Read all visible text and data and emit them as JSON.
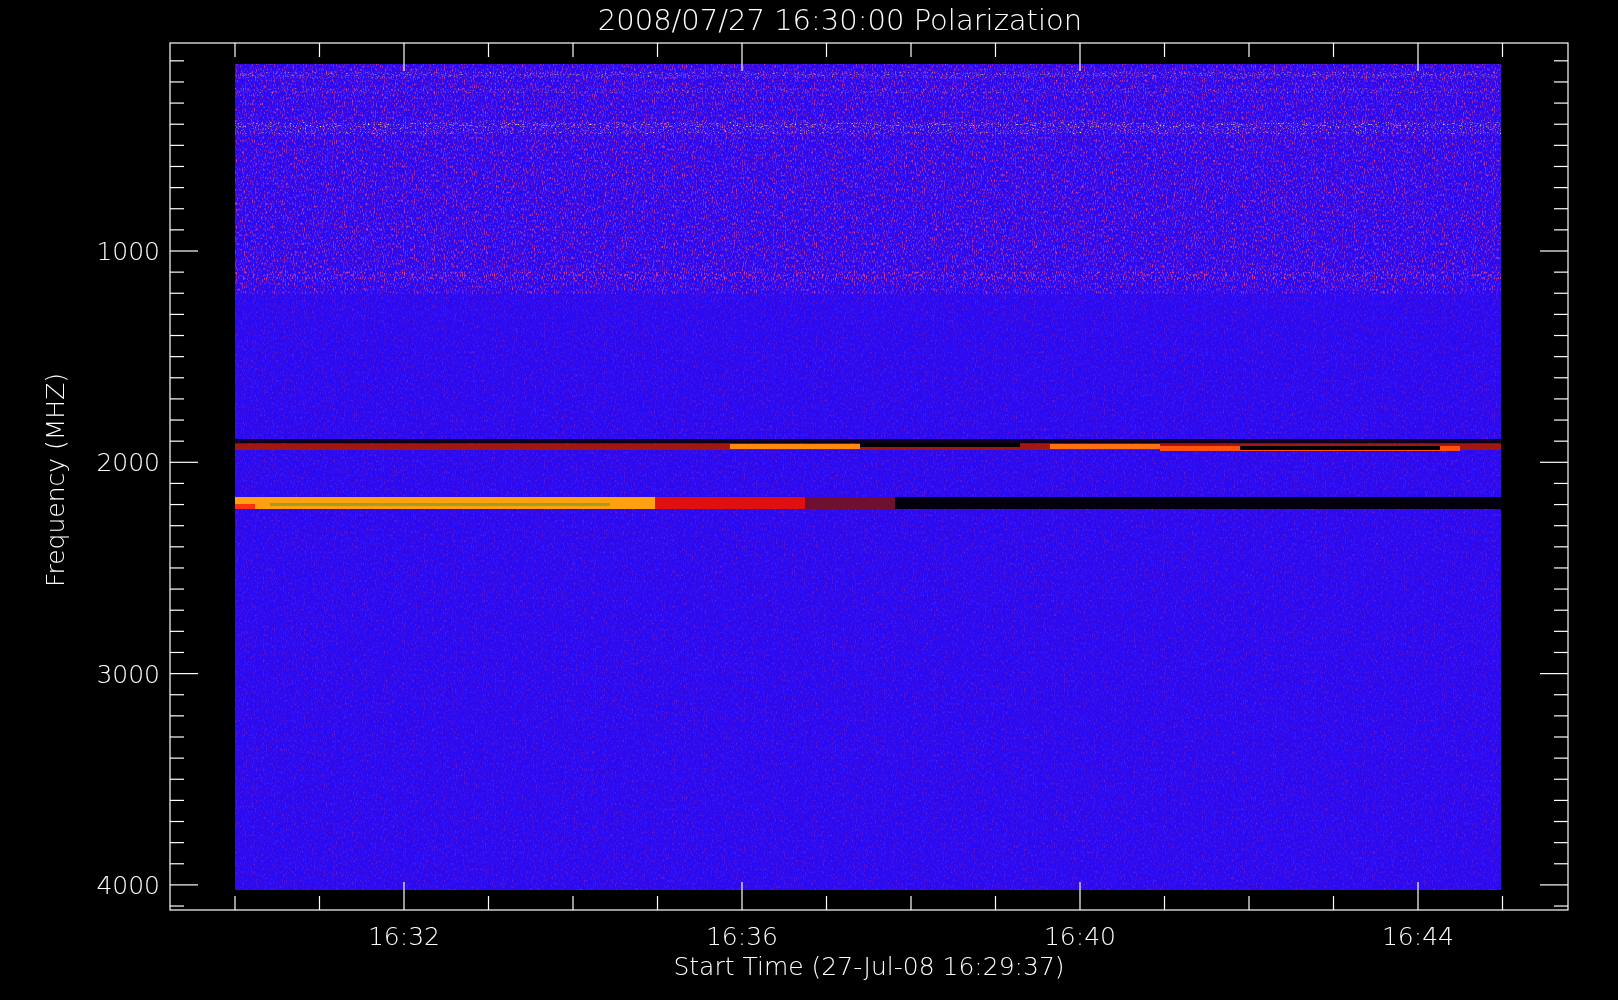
{
  "plot": {
    "title": "2008/07/27 16:30:00 Polarization",
    "y_axis": {
      "label": "Frequency (MHZ)",
      "ticks": [
        "1000",
        "2000",
        "3000",
        "4000"
      ]
    },
    "x_axis": {
      "label": "Start Time (27-Jul-08 16:29:37)",
      "ticks": [
        "16:32",
        "16:36",
        "16:40",
        "16:44"
      ]
    }
  }
}
